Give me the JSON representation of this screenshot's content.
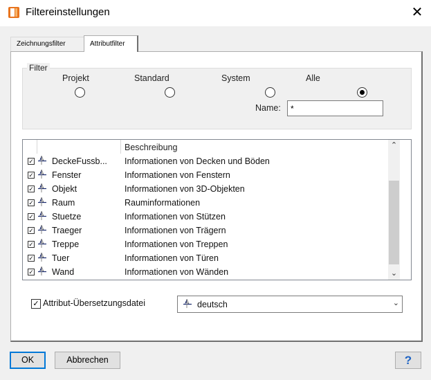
{
  "window": {
    "title": "Filtereinstellungen",
    "close_symbol": "✕",
    "app_icon": "app-layer-icon"
  },
  "tabs": [
    {
      "label": "Zeichnungsfilter",
      "active": false
    },
    {
      "label": "Attributfilter",
      "active": true
    }
  ],
  "filter": {
    "legend": "Filter",
    "options": [
      {
        "label": "Projekt",
        "selected": false
      },
      {
        "label": "Standard",
        "selected": false
      },
      {
        "label": "System",
        "selected": false
      },
      {
        "label": "Alle",
        "selected": true
      }
    ],
    "name_label": "Name:",
    "name_value": "*"
  },
  "list": {
    "column_description": "Beschreibung",
    "rows": [
      {
        "name": "DeckeFussb...",
        "description": "Informationen von Decken und Böden",
        "checked": true
      },
      {
        "name": "Fenster",
        "description": "Informationen von Fenstern",
        "checked": true
      },
      {
        "name": "Objekt",
        "description": "Informationen von 3D-Objekten",
        "checked": true
      },
      {
        "name": "Raum",
        "description": "Rauminformationen",
        "checked": true
      },
      {
        "name": "Stuetze",
        "description": "Informationen von Stützen",
        "checked": true
      },
      {
        "name": "Traeger",
        "description": "Informationen von Trägern",
        "checked": true
      },
      {
        "name": "Treppe",
        "description": "Informationen von Treppen",
        "checked": true
      },
      {
        "name": "Tuer",
        "description": "Informationen von Türen",
        "checked": true
      },
      {
        "name": "Wand",
        "description": "Informationen von Wänden",
        "checked": true
      }
    ],
    "scroll_up": "⌃",
    "scroll_down": "⌄"
  },
  "translation": {
    "label": "Attribut-Übersetzungsdatei",
    "checked": true,
    "value": "deutsch",
    "chevron": "⌄"
  },
  "buttons": {
    "ok": "OK",
    "cancel": "Abbrechen",
    "help": "?"
  },
  "colors": {
    "accent": "#0078d7",
    "help": "#1e63c4",
    "app_icon": "#e8741e"
  }
}
